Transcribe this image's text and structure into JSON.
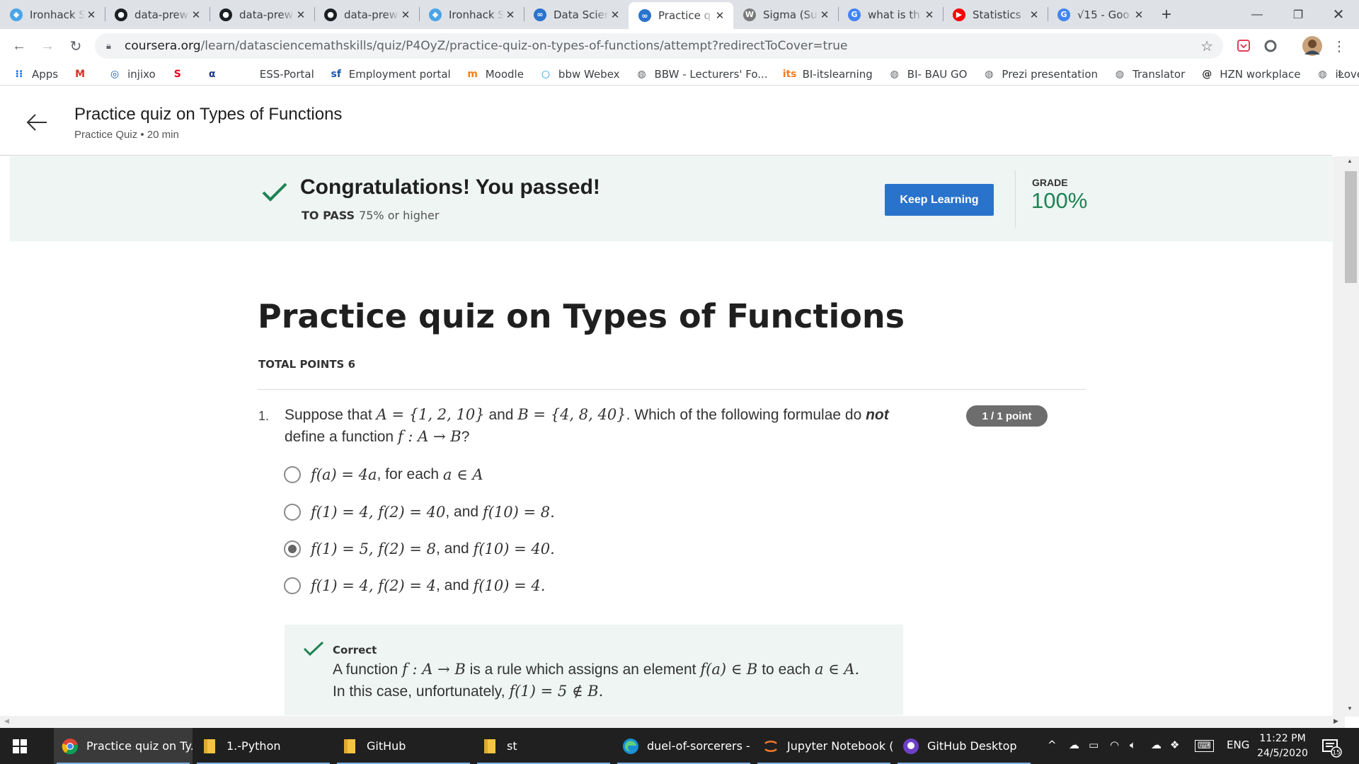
{
  "browser": {
    "tabs": [
      {
        "title": "Ironhack S",
        "icon": "ironhack-icon",
        "color": "#4aa4e8"
      },
      {
        "title": "data-prew",
        "icon": "github-icon",
        "color": "#1b1f23"
      },
      {
        "title": "data-prew",
        "icon": "github-icon",
        "color": "#1b1f23"
      },
      {
        "title": "data-prew",
        "icon": "github-icon",
        "color": "#1b1f23"
      },
      {
        "title": "Ironhack S",
        "icon": "ironhack-icon",
        "color": "#4aa4e8"
      },
      {
        "title": "Data Scien",
        "icon": "coursera-icon",
        "color": "#2a73cc"
      },
      {
        "title": "Practice q",
        "icon": "coursera-icon",
        "color": "#2a73cc"
      },
      {
        "title": "Sigma (Su",
        "icon": "wiki-icon",
        "color": "#7a7a7a"
      },
      {
        "title": "what is th",
        "icon": "google-icon",
        "color": "#4285f4"
      },
      {
        "title": "Statistics",
        "icon": "youtube-icon",
        "color": "#ff0000"
      },
      {
        "title": "√15 - Goo",
        "icon": "google-icon",
        "color": "#4285f4"
      }
    ],
    "active_tab": 6,
    "url_host": "coursera.org",
    "url_path": "/learn/datasciencemathskills/quiz/P4OyZ/practice-quiz-on-types-of-functions/attempt?redirectToCover=true",
    "bookmarks": [
      {
        "label": "Apps",
        "icon": "apps-grid-icon",
        "color": "#1a73e8"
      },
      {
        "label": "",
        "icon": "gmail-icon",
        "color": "#d93025"
      },
      {
        "label": "injixo",
        "icon": "injixo-icon",
        "color": "#1d5fa8"
      },
      {
        "label": "",
        "icon": "sparkasse-icon",
        "color": "#e2001a"
      },
      {
        "label": "",
        "icon": "alpha-icon",
        "color": "#1d3b8c"
      },
      {
        "label": "ESS-Portal",
        "icon": "apple-icon",
        "color": "#555"
      },
      {
        "label": "Employment portal",
        "icon": "sf-icon",
        "color": "#1a56b0"
      },
      {
        "label": "Moodle",
        "icon": "moodle-icon",
        "color": "#f98012"
      },
      {
        "label": "bbw Webex",
        "icon": "webex-icon",
        "color": "#1aa3d6"
      },
      {
        "label": "BBW - Lecturers' Fo...",
        "icon": "globe-icon",
        "color": "#5f6368"
      },
      {
        "label": "BI-itslearning",
        "icon": "its-icon",
        "color": "#f47b20"
      },
      {
        "label": "BI- BAU GO",
        "icon": "globe-icon",
        "color": "#5f6368"
      },
      {
        "label": "Prezi presentation",
        "icon": "globe-icon",
        "color": "#5f6368"
      },
      {
        "label": "Translator",
        "icon": "globe-icon",
        "color": "#5f6368"
      },
      {
        "label": "HZN workplace",
        "icon": "hzn-icon",
        "color": "#333"
      },
      {
        "label": "iLovePDF",
        "icon": "globe-icon",
        "color": "#5f6368"
      }
    ],
    "bookmarks_more": "»"
  },
  "header": {
    "title": "Practice quiz on Types of Functions",
    "subtitle": "Practice Quiz • 20 min"
  },
  "result": {
    "title": "Congratulations! You passed!",
    "to_pass_label": "TO PASS",
    "to_pass_value": "75% or higher",
    "button": "Keep Learning",
    "grade_label": "GRADE",
    "grade_value": "100%",
    "accent_color": "#1f8354",
    "button_color": "#2a73cc"
  },
  "quiz": {
    "title": "Practice quiz on Types of Functions",
    "total_points": "TOTAL POINTS 6",
    "question": {
      "number": "1.",
      "badge": "1 / 1 point",
      "text_1": "Suppose that",
      "math_A": "A = {1, 2, 10}",
      "and": "and",
      "math_B": "B = {4, 8, 40}",
      "text_2": ". Which of the following formulae do",
      "emphasis": "not",
      "text_3": "define a function",
      "math_f": "f : A → B",
      "text_4": "?",
      "options": [
        {
          "math_1": "f(a) = 4a",
          "text": ", for each",
          "math_2": "a ∈ A",
          "selected": false
        },
        {
          "math_1": "f(1) = 4, f(2) = 40",
          "text": ", and",
          "math_2": "f(10) = 8.",
          "selected": false
        },
        {
          "math_1": "f(1) = 5, f(2) = 8",
          "text": ", and",
          "math_2": "f(10) = 40.",
          "selected": true
        },
        {
          "math_1": "f(1) = 4, f(2) = 4",
          "text": ", and",
          "math_2": "f(10) = 4.",
          "selected": false
        }
      ],
      "feedback": {
        "label": "Correct",
        "line1_a": "A function",
        "line1_m1": "f : A → B",
        "line1_b": "is a rule which assigns an element",
        "line1_m2": "f(a) ∈ B",
        "line1_c": "to each",
        "line1_m3": "a ∈ A.",
        "line2_a": "In this case, unfortunately,",
        "line2_m": "f(1) = 5 ∉ B."
      }
    }
  },
  "taskbar": {
    "apps": [
      {
        "label": "Practice quiz on Ty...",
        "icon": "chrome-icon",
        "active": true
      },
      {
        "label": "1.-Python",
        "icon": "folder-icon",
        "active": false
      },
      {
        "label": "GitHub",
        "icon": "folder-icon",
        "active": false
      },
      {
        "label": "st",
        "icon": "folder-icon",
        "active": false
      },
      {
        "label": "duel-of-sorcerers - ...",
        "icon": "edge-icon",
        "active": false
      },
      {
        "label": "Jupyter Notebook (...",
        "icon": "jupyter-icon",
        "active": false
      },
      {
        "label": "GitHub Desktop",
        "icon": "github-desktop-icon",
        "active": false
      }
    ],
    "language": "ENG",
    "time": "11:22 PM",
    "date": "24/5/2020",
    "notifications": "15"
  }
}
